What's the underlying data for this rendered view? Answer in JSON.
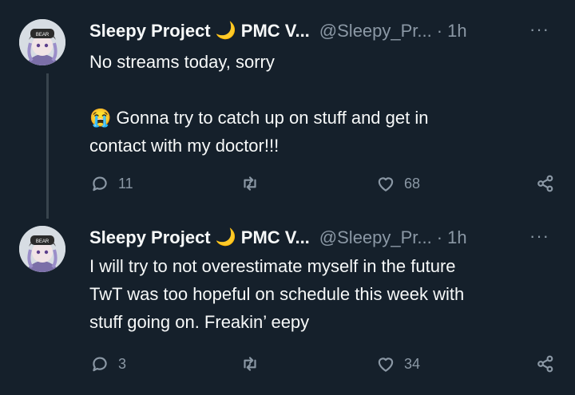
{
  "tweets": [
    {
      "display_name": "Sleepy Project",
      "moon_emoji": "🌙",
      "tag": "PMC V...",
      "handle": "@Sleepy_Pr...",
      "separator": "·",
      "time": "1h",
      "more": "···",
      "lines": [
        "No streams today, sorry",
        "",
        "😭 Gonna try to catch up on stuff and get in",
        "contact with my doctor!!!"
      ],
      "replies": "11",
      "retweets": "",
      "likes": "68"
    },
    {
      "display_name": "Sleepy Project",
      "moon_emoji": "🌙",
      "tag": "PMC V...",
      "handle": "@Sleepy_Pr...",
      "separator": "·",
      "time": "1h",
      "more": "···",
      "lines": [
        "I will try to not overestimate myself in the future",
        "TwT was too hopeful on schedule this week with",
        "stuff going on. Freakin’ eepy"
      ],
      "replies": "3",
      "retweets": "",
      "likes": "34"
    }
  ],
  "colors": {
    "background": "#15202b",
    "text": "#f7f9f9",
    "muted": "#8b98a5",
    "thread_line": "#38444d"
  }
}
